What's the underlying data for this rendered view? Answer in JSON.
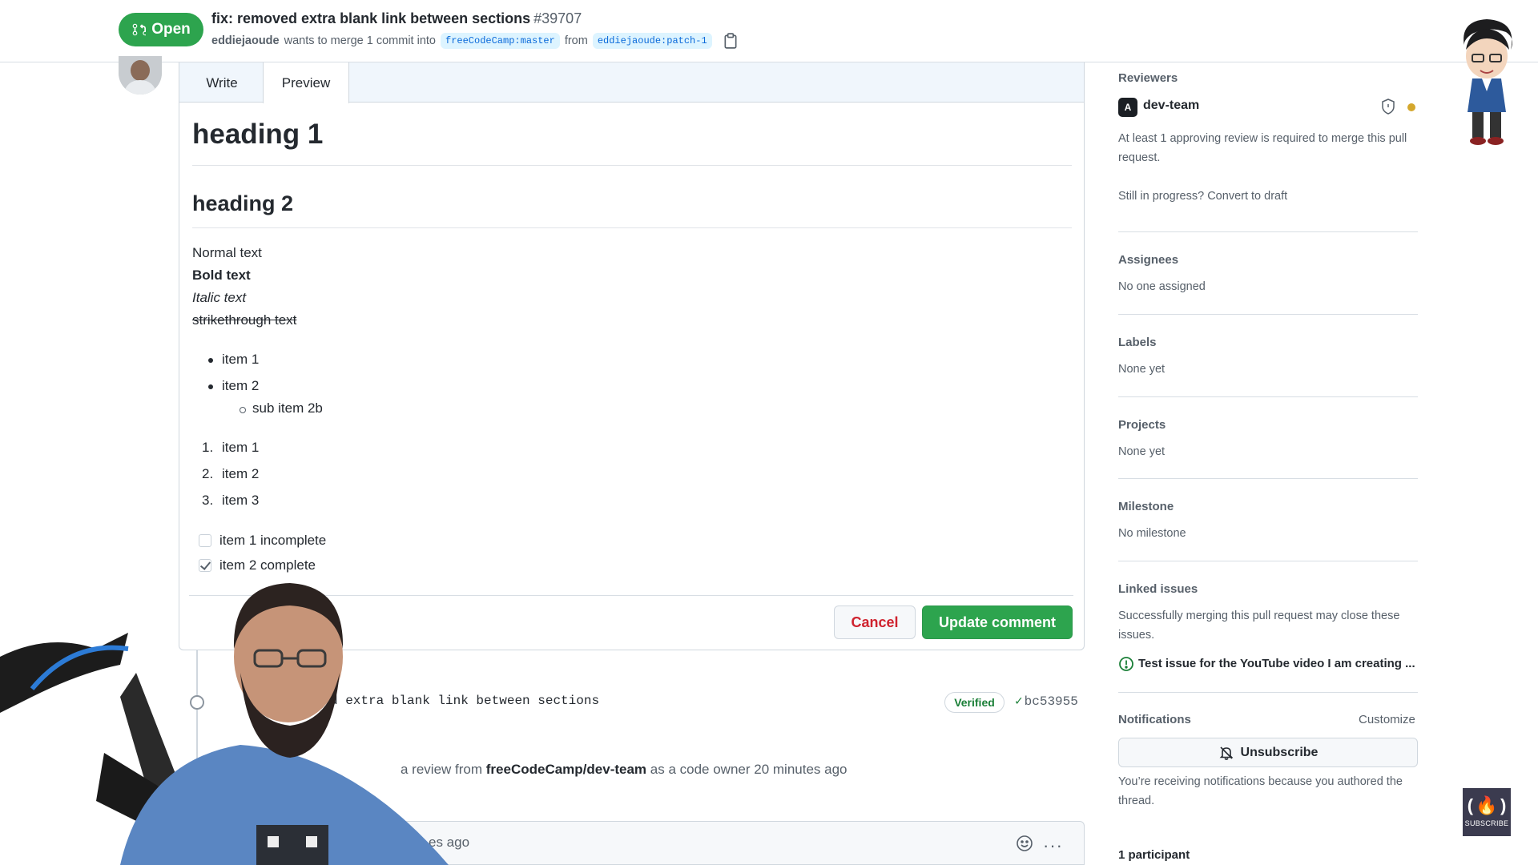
{
  "header": {
    "state": "Open",
    "title": "fix: removed extra blank link between sections",
    "number": "#39707",
    "author": "eddiejaoude",
    "merge_text": "wants to merge 1 commit into",
    "base_branch": "freeCodeCamp:master",
    "from_text": "from",
    "head_branch": "eddiejaoude:patch-1"
  },
  "editor": {
    "tabs": {
      "write": "Write",
      "preview": "Preview"
    },
    "preview": {
      "h1": "heading 1",
      "h2": "heading 2",
      "normal": "Normal text",
      "bold": "Bold text",
      "italic": "Italic text",
      "strike": "strikethrough text",
      "bullets": [
        "item 1",
        "item 2"
      ],
      "sub_bullet": "sub item 2b",
      "ordered": [
        "item 1",
        "item 2",
        "item 3"
      ],
      "ordered_nums": [
        "1.",
        "2.",
        "3."
      ],
      "tasks": [
        {
          "label": "item 1 incomplete",
          "checked": false
        },
        {
          "label": "item 2 complete",
          "checked": true
        }
      ]
    },
    "cancel": "Cancel",
    "update": "Update comment"
  },
  "timeline": {
    "commit_message": "d extra blank link between sections",
    "verified": "Verified",
    "sha": "bc53955",
    "review_prefix": "a review from",
    "review_team": "freeCodeCamp/dev-team",
    "review_suffix": "as a code owner 20 minutes ago",
    "comment_time": "es ago"
  },
  "sidebar": {
    "reviewers": {
      "heading": "Reviewers",
      "team": "dev-team",
      "note": "At least 1 approving review is required to merge this pull request.",
      "draft": "Still in progress? Convert to draft"
    },
    "assignees": {
      "heading": "Assignees",
      "value": "No one assigned"
    },
    "labels": {
      "heading": "Labels",
      "value": "None yet"
    },
    "projects": {
      "heading": "Projects",
      "value": "None yet"
    },
    "milestone": {
      "heading": "Milestone",
      "value": "No milestone"
    },
    "linked_issues": {
      "heading": "Linked issues",
      "note": "Successfully merging this pull request may close these issues.",
      "issue": "Test issue for the YouTube video I am creating ..."
    },
    "notifications": {
      "heading": "Notifications",
      "customize": "Customize",
      "button": "Unsubscribe",
      "note": "You’re receiving notifications because you authored the thread."
    },
    "participants": "1 participant"
  },
  "badge": {
    "glyph": "(🔥)",
    "label": "SUBSCRIBE"
  },
  "colors": {
    "green": "#2da44e",
    "danger": "#cf222e",
    "link": "#0969da",
    "pending": "#d4a72c"
  }
}
